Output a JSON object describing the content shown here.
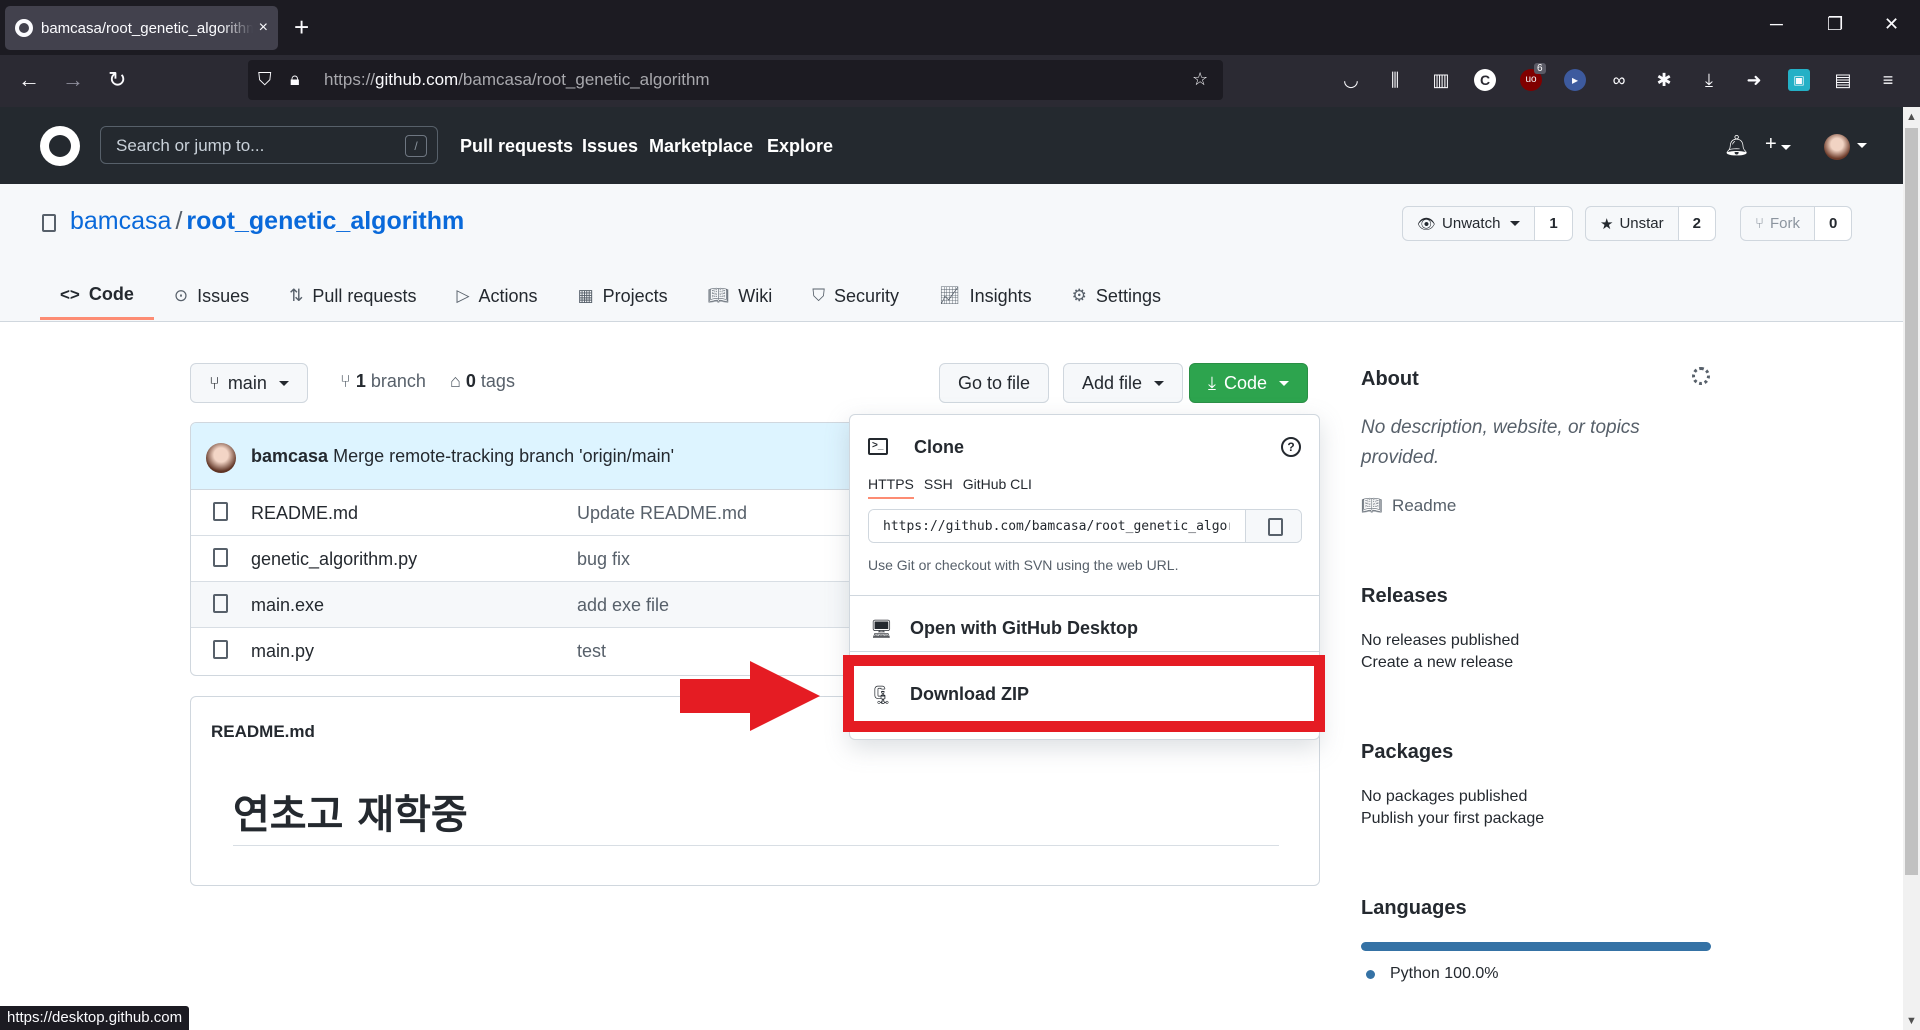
{
  "browser": {
    "tab_title": "bamcasa/root_genetic_algorithm",
    "tab_close": "×",
    "new_tab": "+",
    "url_prefix": "https://",
    "url_host": "github.com",
    "url_path": "/bamcasa/root_genetic_algorithm",
    "window_minimize": "─",
    "window_restore": "❐",
    "window_close": "✕",
    "ext_badge": "6",
    "status_url": "https://desktop.github.com"
  },
  "github": {
    "search_placeholder": "Search or jump to...",
    "search_key": "/",
    "nav": [
      "Pull requests",
      "Issues",
      "Marketplace",
      "Explore"
    ]
  },
  "repo": {
    "owner": "bamcasa",
    "separator": "/",
    "name": "root_genetic_algorithm",
    "watch_label": "Unwatch",
    "watch_count": "1",
    "star_label": "Unstar",
    "star_count": "2",
    "fork_label": "Fork",
    "fork_count": "0",
    "tabs": [
      "Code",
      "Issues",
      "Pull requests",
      "Actions",
      "Projects",
      "Wiki",
      "Security",
      "Insights",
      "Settings"
    ],
    "active_tab": "Code"
  },
  "code": {
    "branch": "main",
    "branch_count": "1",
    "branch_label": "branch",
    "tag_count": "0",
    "tag_label": "tags",
    "go_to_file": "Go to file",
    "add_file": "Add file",
    "code_button": "Code",
    "commit_author": "bamcasa",
    "commit_message": "Merge remote-tracking branch 'origin/main'",
    "files": [
      {
        "name": "README.md",
        "message": "Update README.md"
      },
      {
        "name": "genetic_algorithm.py",
        "message": "bug fix"
      },
      {
        "name": "main.exe",
        "message": "add exe file"
      },
      {
        "name": "main.py",
        "message": "test"
      }
    ],
    "readme_header": "README.md",
    "readme_heading": "연초고 재학중"
  },
  "clone": {
    "title": "Clone",
    "tabs": [
      "HTTPS",
      "SSH",
      "GitHub CLI"
    ],
    "active_tab": "HTTPS",
    "url": "https://github.com/bamcasa/root_genetic_algorithm.git",
    "hint": "Use Git or checkout with SVN using the web URL.",
    "open_desktop": "Open with GitHub Desktop",
    "download_zip": "Download ZIP"
  },
  "sidebar": {
    "about_title": "About",
    "about_desc": "No description, website, or topics provided.",
    "readme_link": "Readme",
    "releases_title": "Releases",
    "releases_text": "No releases published",
    "releases_link": "Create a new release",
    "packages_title": "Packages",
    "packages_text": "No packages published",
    "packages_link": "Publish your first package",
    "languages_title": "Languages",
    "language_name": "Python",
    "language_percent": "100.0%"
  },
  "colors": {
    "highlight": "#e51c23",
    "python": "#3572a5",
    "green_button": "#2da44e",
    "link": "#0969da"
  }
}
